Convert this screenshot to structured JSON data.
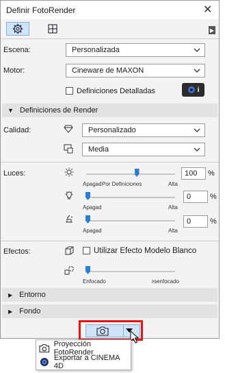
{
  "window": {
    "title": "Definir FotoRender"
  },
  "tabs": [
    {
      "icon": "gear-icon"
    },
    {
      "icon": "grid-icon"
    }
  ],
  "scene": {
    "label": "Escena:",
    "value": "Personalizada"
  },
  "engine": {
    "label": "Motor:",
    "value": "Cineware de MAXON"
  },
  "detailed": {
    "label": "Definiciones Detalladas",
    "checked": false,
    "info_label": "i"
  },
  "render_settings": {
    "title": "Definiciones de Render",
    "expanded": true
  },
  "quality": {
    "label": "Calidad:",
    "value1": "Personalizado",
    "value2": "Media"
  },
  "lights": {
    "label": "Luces:",
    "sliders": [
      {
        "value": "100",
        "unit": "%",
        "level": 0.55,
        "left": "Apagad",
        "mid": "Por Definiciones",
        "right": "Alta"
      },
      {
        "value": "0",
        "unit": "%",
        "level": 0.0,
        "left": "Apagad",
        "right": "Alta"
      },
      {
        "value": "0",
        "unit": "%",
        "level": 0.0,
        "left": "Apagad",
        "right": "Alta"
      }
    ]
  },
  "effects": {
    "label": "Efectos:",
    "white_model_label": "Utilizar Efecto Modelo Blanco",
    "white_model_checked": false,
    "slider": {
      "level": 0.0,
      "left": "Enfocado",
      "right": "Desenfocado"
    }
  },
  "sections": {
    "environment": "Entorno",
    "background": "Fondo"
  },
  "menu": {
    "items": [
      "Proyección FotoRender",
      "Exportar a CINEMA 4D"
    ]
  },
  "colors": {
    "accent": "#2a7fd4",
    "highlight": "#cfe3fa",
    "annotation": "#ee1111"
  }
}
